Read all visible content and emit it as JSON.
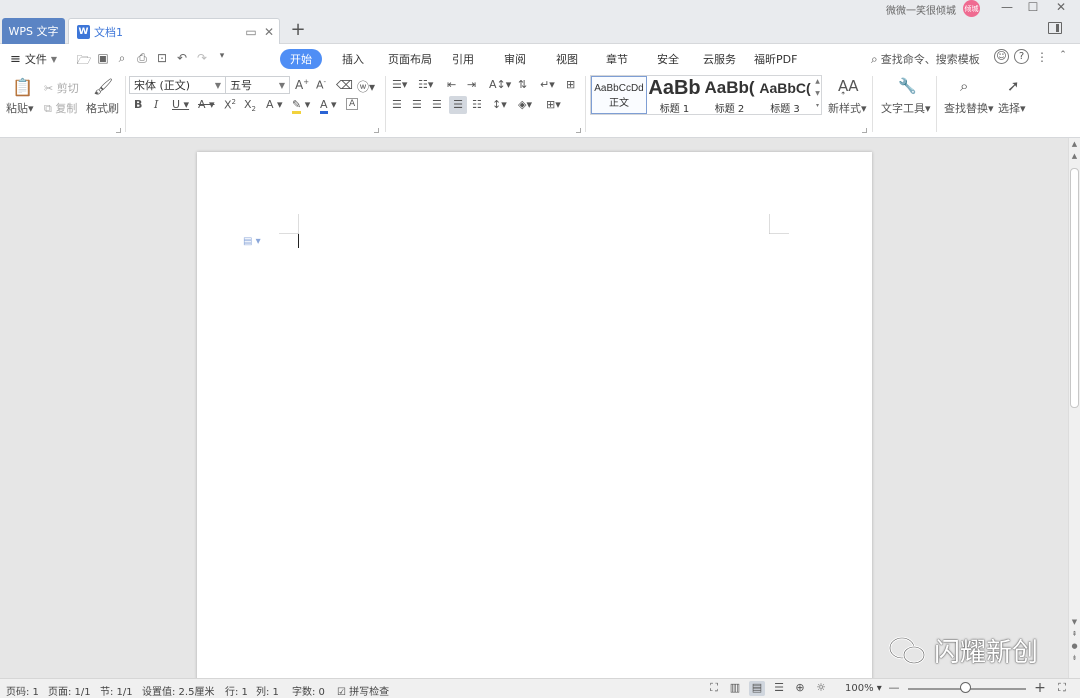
{
  "titlebar": {
    "app_tab": "WPS 文字",
    "doc_tab": "文档1",
    "doc_icon": "W",
    "add_tab": "+",
    "user_name": "微微一笑很倾城",
    "avatar_text": "倾城",
    "avatar_color": "#ef6b91"
  },
  "menu": {
    "file_label": "文件",
    "tabs": [
      "开始",
      "插入",
      "页面布局",
      "引用",
      "审阅",
      "视图",
      "章节",
      "安全",
      "云服务",
      "福昕PDF"
    ],
    "active_tab": "开始",
    "search_label": "查找命令、搜索模板"
  },
  "ribbon": {
    "paste": "粘贴",
    "cut": "剪切",
    "copy": "复制",
    "format_painter": "格式刷",
    "font_name": "宋体 (正文)",
    "font_size": "五号",
    "styles": [
      {
        "sample": "AaBbCcDd",
        "name": "正文"
      },
      {
        "sample": "AaBb",
        "name": "标题 1"
      },
      {
        "sample": "AaBb(",
        "name": "标题 2"
      },
      {
        "sample": "AaBbC(",
        "name": "标题 3"
      }
    ],
    "new_style": "新样式",
    "text_tools": "文字工具",
    "find_replace": "查找替换",
    "select": "选择"
  },
  "statusbar": {
    "page_num": "页码: 1",
    "pages": "页面: 1/1",
    "section": "节: 1/1",
    "position": "设置值: 2.5厘米",
    "row": "行: 1",
    "col": "列: 1",
    "word_count": "字数: 0",
    "spell_check": "拼写检查",
    "zoom": "100%"
  },
  "watermark": {
    "text": "闪耀新创"
  },
  "colors": {
    "accent": "#4f8ef5",
    "app_tab": "#5b84c4",
    "doc_blue": "#3d76d8"
  }
}
